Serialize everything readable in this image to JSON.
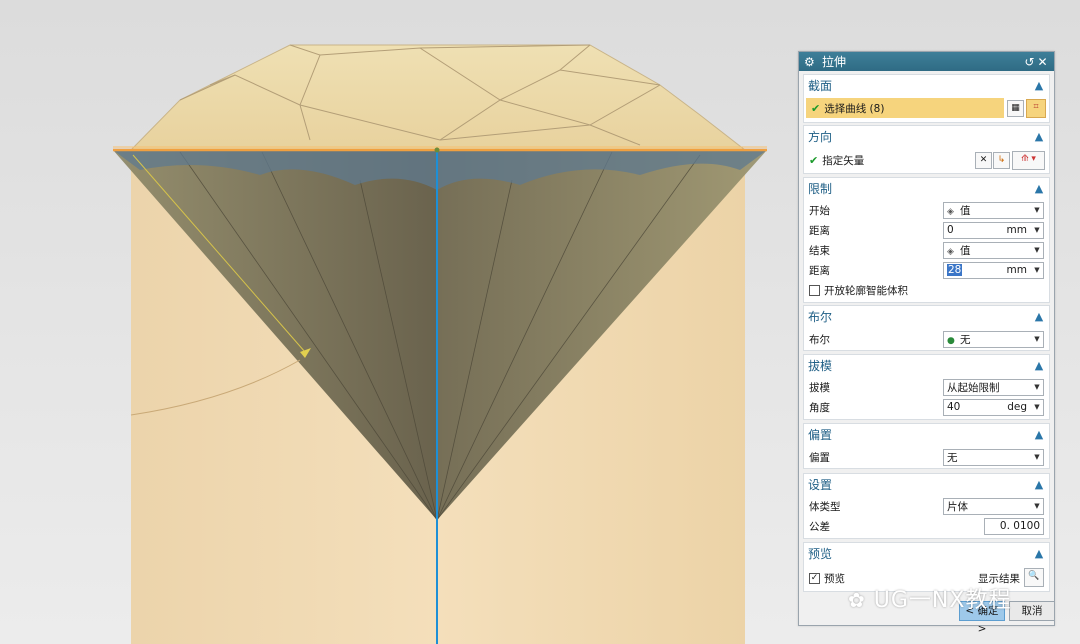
{
  "dialog": {
    "title": "拉伸",
    "sections": {
      "section": {
        "title": "截面",
        "select_curve": "选择曲线 (8)"
      },
      "direction": {
        "title": "方向",
        "specify_vector": "指定矢量"
      },
      "limits": {
        "title": "限制",
        "start_label": "开始",
        "start_value": "值",
        "distance1_label": "距离",
        "distance1_value": "0",
        "distance1_unit": "mm",
        "end_label": "结束",
        "end_value": "值",
        "distance2_label": "距离",
        "distance2_value": "28",
        "distance2_unit": "mm",
        "open_profile_label": "开放轮廓智能体积"
      },
      "boolean": {
        "title": "布尔",
        "boolean_label": "布尔",
        "boolean_value": "无"
      },
      "draft": {
        "title": "拔模",
        "draft_label": "拔模",
        "draft_value": "从起始限制",
        "angle_label": "角度",
        "angle_value": "40",
        "angle_unit": "deg"
      },
      "offset": {
        "title": "偏置",
        "offset_label": "偏置",
        "offset_value": "无"
      },
      "settings": {
        "title": "设置",
        "body_type_label": "体类型",
        "body_type_value": "片体",
        "tolerance_label": "公差",
        "tolerance_value": "0. 0100"
      },
      "preview": {
        "title": "预览",
        "preview_label": "预览",
        "show_result_label": "显示结果"
      }
    },
    "buttons": {
      "ok": "< 确定 >",
      "cancel": "取消"
    }
  },
  "watermark": "UG一NX教程",
  "colors": {
    "solid_face": "#f3dcb4",
    "top_face": "#eddcac",
    "cone_dark": "#6d6650",
    "edge_highlight": "#f0a040",
    "axis_line": "#1d8fd6",
    "title_bar": "#2f6b84",
    "selection_highlight": "#f6d47d"
  }
}
